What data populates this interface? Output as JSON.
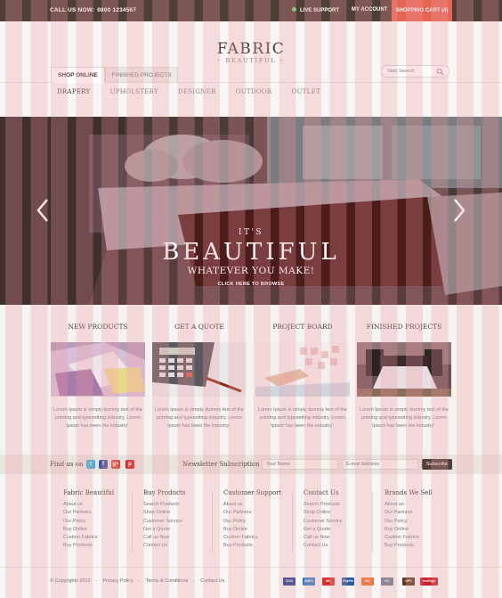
{
  "topbar": {
    "call_label": "CALL US NOW:",
    "phone": "0800 1234567",
    "live_support": "LIVE SUPPORT",
    "my_account": "MY ACCOUNT",
    "cart": "SHOPPING CART (4)"
  },
  "logo": {
    "name": "FABRIC",
    "tagline": "BEAUTIFUL"
  },
  "tabs": [
    "SHOP ONLINE",
    "FINISHED PROJECTS"
  ],
  "search": {
    "placeholder": "Start Search"
  },
  "subnav": [
    "DRAPERY",
    "UPHOLSTERY",
    "DESIGNER",
    "OUTDOOR",
    "OUTLET"
  ],
  "hero": {
    "line1": "IT'S",
    "line2": "BEAUTIFUL",
    "line3": "WHATEVER YOU MAKE!",
    "cta": "CLICK HERE TO BROWSE"
  },
  "features": [
    {
      "title": "NEW PRODUCTS",
      "text": "Lorem Ipsum is simply dummy text of the printing and typesetting industry. Lorem Ipsum has been the industry'."
    },
    {
      "title": "GET A QUOTE",
      "text": "Lorem Ipsum is simply dummy text of the printing and typesetting industry. Lorem Ipsum has been the industry'."
    },
    {
      "title": "PROJECT BOARD",
      "text": "Lorem Ipsum is simply dummy text of the printing and typesetting industry. Lorem Ipsum has been the industry'."
    },
    {
      "title": "FINISHED PROJECTS",
      "text": "Lorem Ipsum is simply dummy text of the printing and typesetting industry. Lorem Ipsum has been the industry'."
    }
  ],
  "social": {
    "find_us": "Find us on",
    "newsletter": "Newsletter Subscription",
    "name_placeholder": "Your Name",
    "email_placeholder": "E-mail Address",
    "subscribe": "Subscribe",
    "icons": [
      "t",
      "f",
      "g+",
      "p"
    ]
  },
  "footer_columns": [
    {
      "heading": "Fabric Beautiful",
      "items": [
        "About us",
        "Our Partners",
        "Our Policy",
        "Buy Online",
        "Custom Fabrics",
        "Buy Products"
      ]
    },
    {
      "heading": "Buy Products",
      "items": [
        "Search Products",
        "Shop Online",
        "Customer Service",
        "Get a Quote",
        "Call us Now",
        "Contact Us"
      ]
    },
    {
      "heading": "Customer Support",
      "items": [
        "About us",
        "Our Partners",
        "Our Policy",
        "Buy Online",
        "Custom Fabrics",
        "Buy Products"
      ]
    },
    {
      "heading": "Contact Us",
      "items": [
        "Search Products",
        "Shop Online",
        "Customer Service",
        "Get a Quote",
        "Call us Now",
        "Contact Us"
      ]
    },
    {
      "heading": "Brands We Sell",
      "items": [
        "About us",
        "Our Partners",
        "Our Policy",
        "Buy Online",
        "Custom Fabrics",
        "Buy Products"
      ]
    }
  ],
  "bottom": {
    "copyright": "© Copyrights 2012",
    "links": [
      "Privacy Policy",
      "Terms & Conditions",
      "Contact Us"
    ]
  },
  "payments": [
    "VISA",
    "AMEX",
    "MC",
    "PayPal",
    "MC",
    "GC",
    "UPS",
    "VeriSign"
  ],
  "colors": {
    "topbar": "#4f3f38",
    "cart": "#e56552",
    "accent": "#4a3b35"
  }
}
